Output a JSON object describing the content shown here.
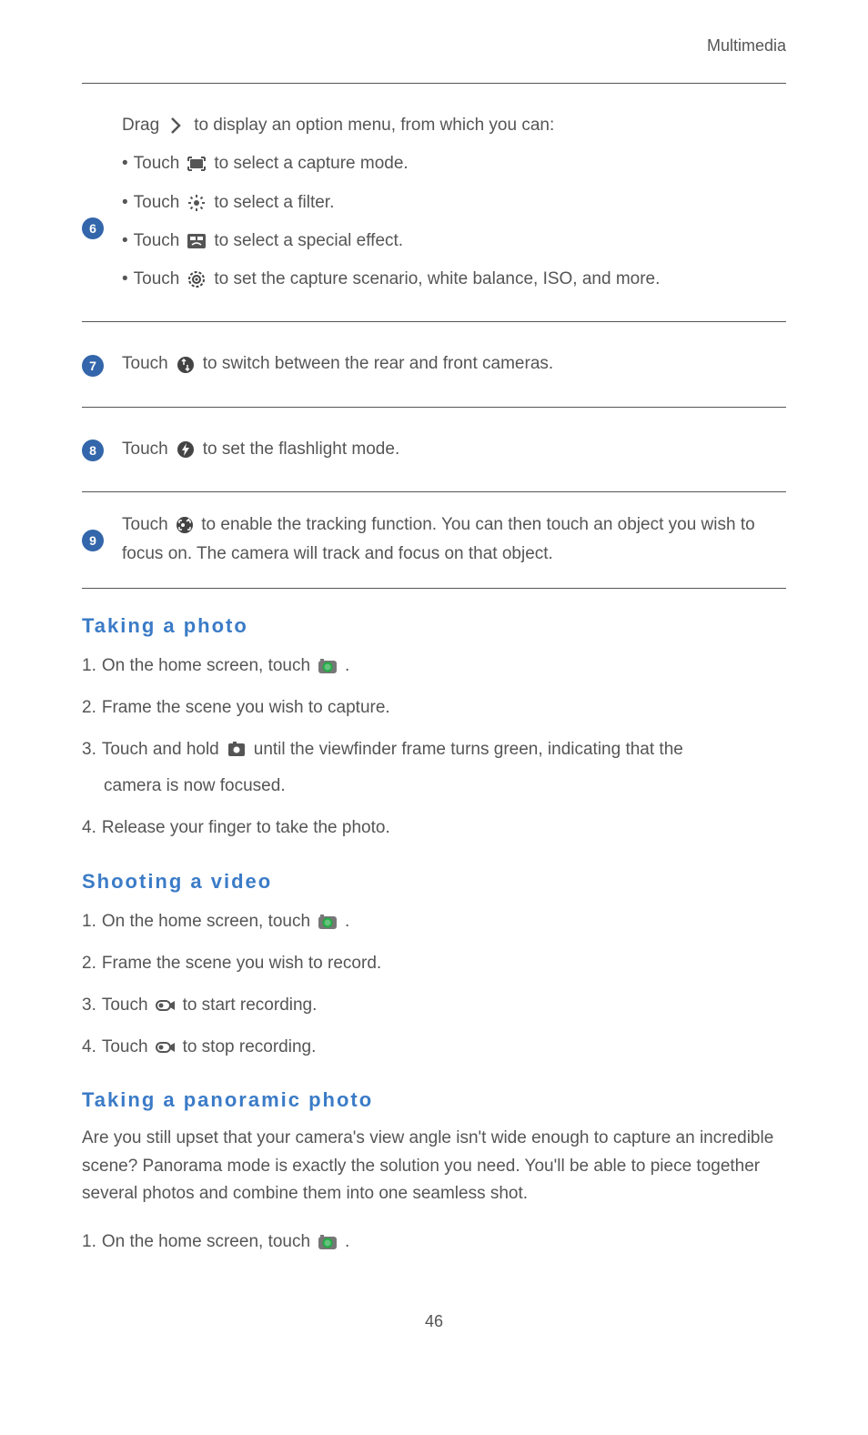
{
  "header": "Multimedia",
  "rows": [
    {
      "num": "6",
      "drag_pre": "Drag ",
      "drag_post": " to display an option menu, from which you can:",
      "items": [
        {
          "pre": "Touch ",
          "icon": "capture-mode-icon",
          "post": " to select a capture mode."
        },
        {
          "pre": "Touch ",
          "icon": "filter-icon",
          "post": " to select a filter."
        },
        {
          "pre": "Touch ",
          "icon": "effect-icon",
          "post": " to select a special effect."
        },
        {
          "pre": "Touch ",
          "icon": "settings-gear-icon",
          "post": " to set the capture scenario, white balance, ISO, and more."
        }
      ]
    },
    {
      "num": "7",
      "pre": "Touch ",
      "icon": "switch-camera-icon",
      "post": " to switch between the rear and front cameras."
    },
    {
      "num": "8",
      "pre": "Touch ",
      "icon": "flash-icon",
      "post": " to set the flashlight mode."
    },
    {
      "num": "9",
      "pre": "Touch ",
      "icon": "tracking-icon",
      "post": " to enable the tracking function. You can then touch an object you wish to focus on. The camera will track and focus on that object."
    }
  ],
  "sections": [
    {
      "heading": "Taking  a  photo",
      "steps": [
        {
          "pre": "On the home screen, touch ",
          "icon": "camera-app-icon",
          "post": " ."
        },
        {
          "pre": "Frame the scene you wish to capture."
        },
        {
          "pre": "Touch and hold ",
          "icon": "shutter-icon",
          "post": " until the viewfinder frame turns green, indicating that the",
          "indent": "camera is now focused."
        },
        {
          "pre": "Release your finger to take the photo."
        }
      ]
    },
    {
      "heading": "Shooting  a  video",
      "steps": [
        {
          "pre": "On the home screen, touch ",
          "icon": "camera-app-icon",
          "post": " ."
        },
        {
          "pre": "Frame the scene you wish to record."
        },
        {
          "pre": "Touch ",
          "icon": "record-icon",
          "post": "to start recording."
        },
        {
          "pre": "Touch ",
          "icon": "record-icon",
          "post": "to stop recording."
        }
      ]
    },
    {
      "heading": "Taking  a  panoramic  photo",
      "para": "Are you still upset that your camera's view angle isn't wide enough to capture an incredible scene? Panorama mode is exactly the solution you need. You'll be able to piece together several photos and combine them into one seamless shot.",
      "steps": [
        {
          "pre": "On the home screen, touch ",
          "icon": "camera-app-icon",
          "post": " ."
        }
      ]
    }
  ],
  "page_number": "46"
}
